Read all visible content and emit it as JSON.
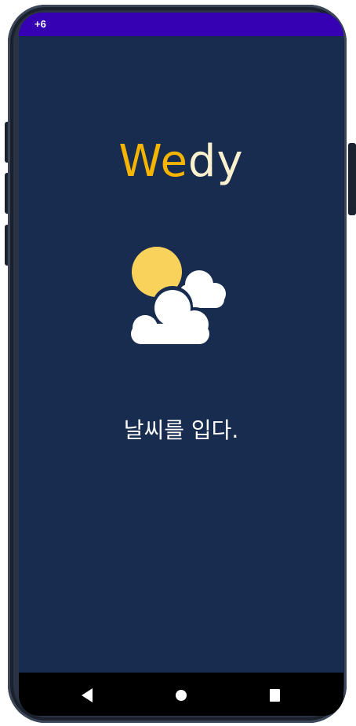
{
  "status_bar": {
    "text": "+6",
    "color": "#3600b3"
  },
  "logo": {
    "part1": "We",
    "part2": "dy",
    "part1_color": "#f5b400",
    "part2_color": "#fbf1cf"
  },
  "illustration": {
    "icon": "sun-behind-clouds-icon"
  },
  "tagline": "날씨를 입다.",
  "background_color": "#182c4f",
  "nav": {
    "back_icon": "back-triangle-icon",
    "home_icon": "home-circle-icon",
    "recents_icon": "recents-square-icon"
  }
}
